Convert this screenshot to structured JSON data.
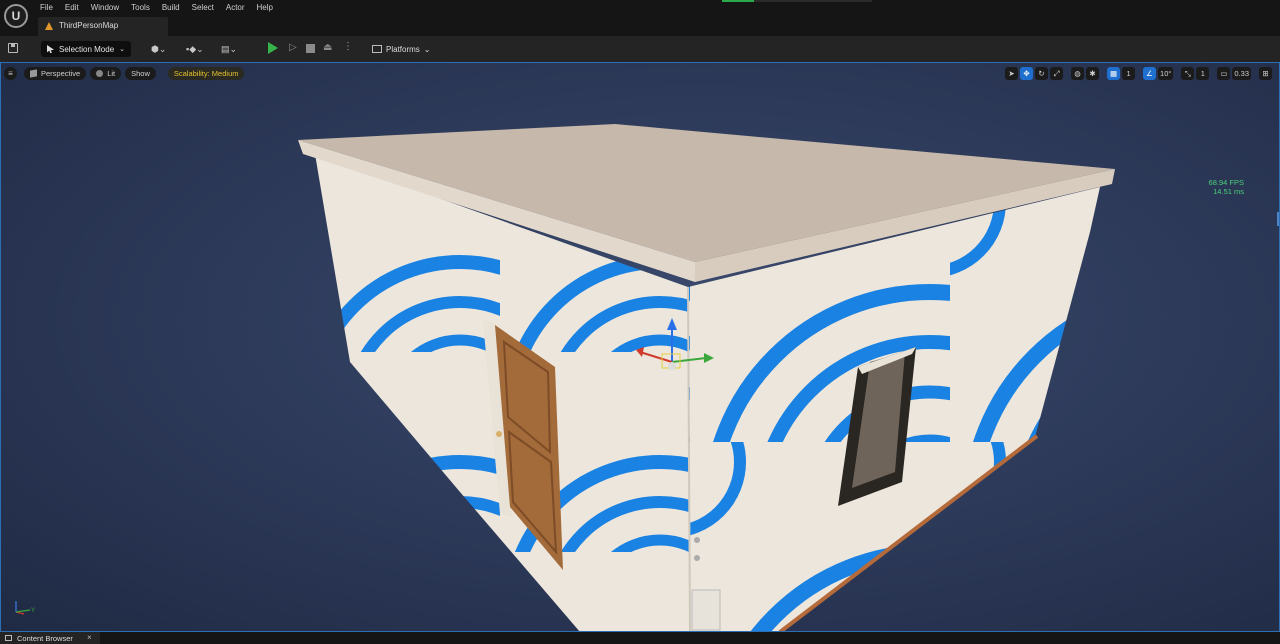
{
  "menu": [
    "File",
    "Edit",
    "Window",
    "Tools",
    "Build",
    "Select",
    "Actor",
    "Help"
  ],
  "map_tab": {
    "label": "ThirdPersonMap"
  },
  "toolbar": {
    "selection_mode": "Selection Mode",
    "platforms": "Platforms"
  },
  "viewport": {
    "view_mode": "Perspective",
    "lighting": "Lit",
    "show": "Show",
    "scalability": "Scalability: Medium",
    "grid_snap": "1",
    "rotation_snap": "10°",
    "scale_snap": "1",
    "camera_speed": "0.33",
    "fps": "68.94 FPS",
    "frame_ms": "14.51 ms",
    "axis_labels": {
      "z": "Z",
      "x": "X",
      "y": "Y"
    }
  },
  "bottom_tab": {
    "label": "Content Browser",
    "close": "×"
  },
  "colors": {
    "play_green": "#36b34a",
    "scalability_yellow": "#e4c12f",
    "active_tool_blue": "#1f6fd0",
    "viewport_blue": "#2e3b5b",
    "wall_stripe_blue": "#1a82e2"
  },
  "icons": [
    "unreal-logo-icon",
    "save-icon",
    "selection-arrow-icon",
    "add-actor-icon",
    "blueprint-icon",
    "cinematics-icon",
    "play-icon",
    "advance-frame-icon",
    "stop-icon",
    "eject-icon",
    "platforms-icon",
    "menu-icon",
    "select-tool-icon",
    "translate-icon",
    "rotate-icon",
    "scale-icon",
    "world-local-icon",
    "surface-snap-icon",
    "grid-snap-icon",
    "rotation-snap-icon",
    "scale-snap-icon",
    "camera-speed-icon",
    "maximize-icon"
  ]
}
